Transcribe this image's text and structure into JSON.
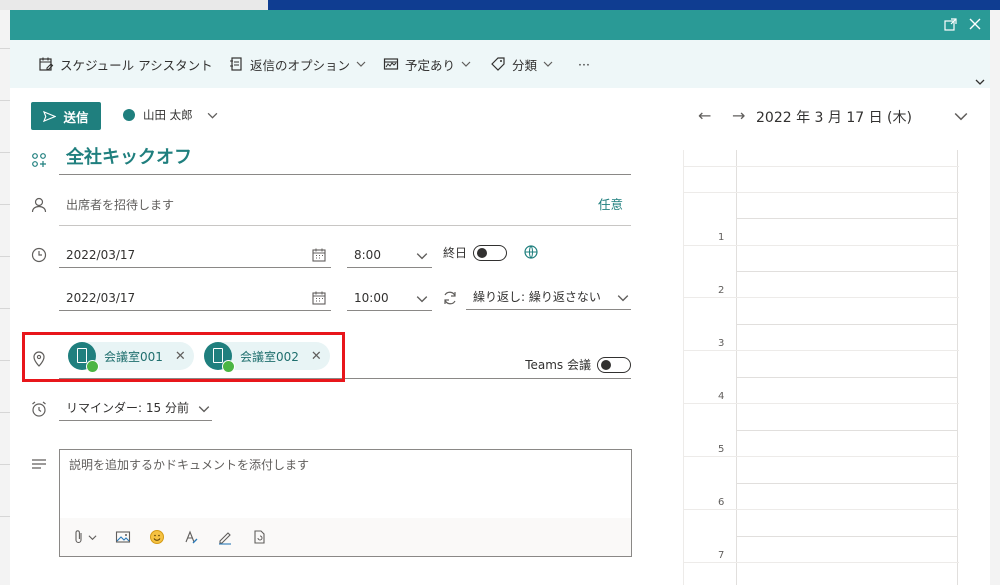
{
  "toolbar": {
    "scheduling_assistant": "スケジュール アシスタント",
    "response_options": "返信のオプション",
    "busy_status": "予定あり",
    "categorize": "分類",
    "more": "···"
  },
  "compose": {
    "send_label": "送信",
    "account_name": "山田 太郎"
  },
  "event": {
    "title": "全社キックオフ",
    "attendees_placeholder": "出席者を招待します",
    "optional_label": "任意",
    "start_date": "2022/03/17",
    "start_time": "8:00",
    "end_date": "2022/03/17",
    "end_time": "10:00",
    "all_day_label": "終日",
    "all_day_on": false,
    "recurrence": "繰り返し: 繰り返さない",
    "rooms": [
      {
        "name": "会議室001",
        "status": "available"
      },
      {
        "name": "会議室002",
        "status": "available"
      }
    ],
    "teams_label": "Teams 会議",
    "teams_on": false,
    "reminder": "リマインダー: 15 分前",
    "description_placeholder": "説明を追加するかドキュメントを添付します"
  },
  "calendar": {
    "date_label": "2022 年 3 月 17 日 (木)",
    "hours": [
      "1",
      "2",
      "3",
      "4",
      "5",
      "6",
      "7"
    ]
  },
  "colors": {
    "titlebar": "#2a9a96",
    "accent": "#1f7f7e",
    "highlight": "#e8161b",
    "toolbar_bg": "#eef7f8"
  }
}
